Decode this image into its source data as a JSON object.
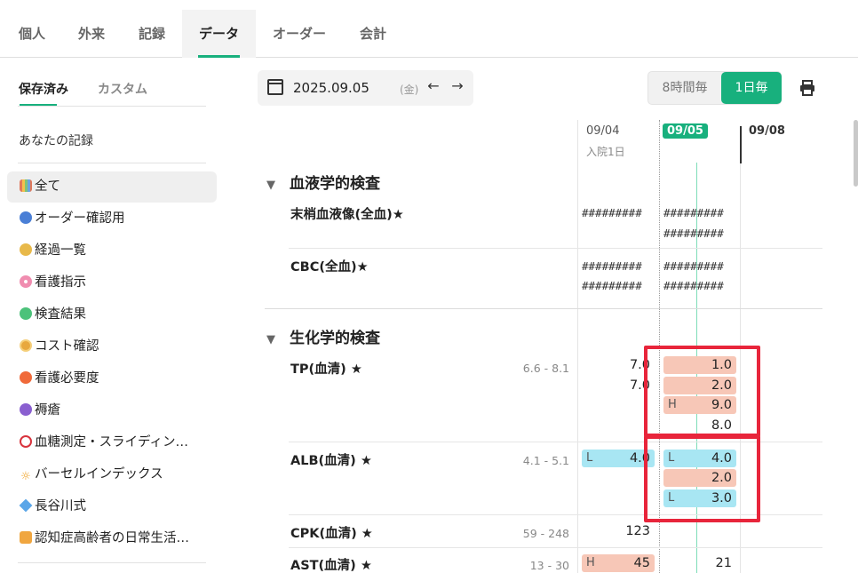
{
  "tabs": [
    "個人",
    "外来",
    "記録",
    "データ",
    "オーダー",
    "会計"
  ],
  "sidebar": {
    "tabs": [
      "保存済み",
      "カスタム"
    ],
    "section_label": "あなたの記録",
    "items": [
      {
        "label": "全て",
        "icon": "grid-icon",
        "color": "#e0785a"
      },
      {
        "label": "オーダー確認用",
        "icon": "blue-circle-icon",
        "color": "#4a7fd6"
      },
      {
        "label": "経過一覧",
        "icon": "yellow-circle-icon",
        "color": "#e8b94a"
      },
      {
        "label": "看護指示",
        "icon": "cherry-blossom-icon",
        "color": "#f08db0"
      },
      {
        "label": "検査結果",
        "icon": "green-circle-icon",
        "color": "#4cc27a"
      },
      {
        "label": "コスト確認",
        "icon": "coin-icon",
        "color": "#e8a83e"
      },
      {
        "label": "看護必要度",
        "icon": "orange-circle-icon",
        "color": "#f06a3a"
      },
      {
        "label": "褥瘡",
        "icon": "purple-circle-icon",
        "color": "#8a5fd0"
      },
      {
        "label": "血糖測定・スライディン…",
        "icon": "red-ring-icon",
        "color": "#d8333d"
      },
      {
        "label": "バーセルインデックス",
        "icon": "sun-icon",
        "color": "#f0a020"
      },
      {
        "label": "長谷川式",
        "icon": "blue-diamond-icon",
        "color": "#5ba6e8"
      },
      {
        "label": "認知症高齢者の日常生活…",
        "icon": "orange-square-icon",
        "color": "#f0a640"
      }
    ]
  },
  "toolbar": {
    "date": "2025.09.05",
    "day": "(金)",
    "interval_options": [
      "8時間毎",
      "1日毎"
    ],
    "active_interval": "1日毎"
  },
  "columns": {
    "d1": "09/04",
    "d1_sub": "入院1日",
    "d2": "09/05",
    "d3": "09/08"
  },
  "sections": {
    "blood": {
      "title": "血液学的検査",
      "rows": [
        {
          "name": "末梢血液像(全血)★",
          "col1": [
            "#########"
          ],
          "col2": [
            "#########",
            "#########"
          ]
        },
        {
          "name": "CBC(全血)★",
          "col1": [
            "#########",
            "#########"
          ],
          "col2": [
            "#########",
            "#########"
          ]
        }
      ]
    },
    "biochem": {
      "title": "生化学的検査",
      "rows": [
        {
          "name": "TP(血清) ★",
          "range": "6.6 - 8.1",
          "col1": [
            "7.0",
            "7.0"
          ],
          "col2": [
            "1.0",
            "2.0",
            "9.0",
            "8.0"
          ],
          "col2_flags": [
            "",
            "",
            "H",
            ""
          ]
        },
        {
          "name": "ALB(血清) ★",
          "range": "4.1 - 5.1",
          "col1": [
            "4.0"
          ],
          "col1_flags": [
            "L"
          ],
          "col2": [
            "4.0",
            "2.0",
            "3.0"
          ],
          "col2_flags": [
            "L",
            "",
            "L"
          ]
        },
        {
          "name": "CPK(血清) ★",
          "range": "59 - 248",
          "col1": [
            "123"
          ],
          "col2": []
        },
        {
          "name": "AST(血清) ★",
          "range": "13 - 30",
          "col1": [
            "45"
          ],
          "col1_flags": [
            "H"
          ],
          "col2": [
            "21"
          ]
        }
      ]
    }
  },
  "colors": {
    "accent": "#18b07d",
    "high": "#f7c7b7",
    "low": "#a8e6f3",
    "highlight_box": "#e8253b"
  }
}
